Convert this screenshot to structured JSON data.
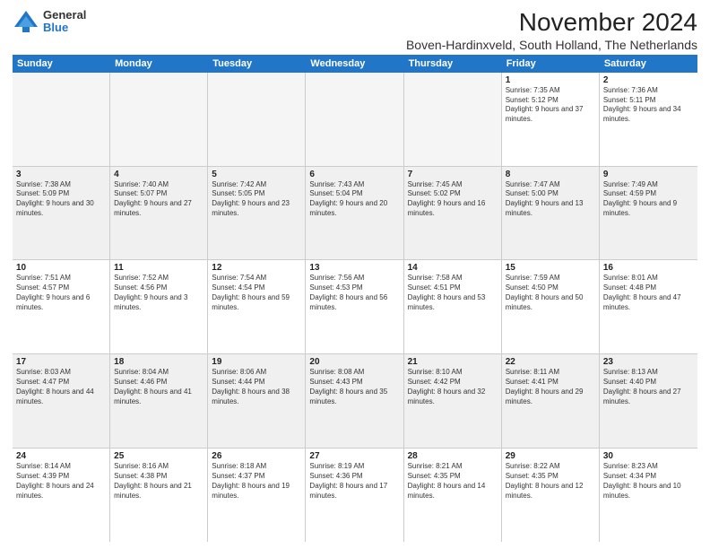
{
  "logo": {
    "general": "General",
    "blue": "Blue"
  },
  "title": "November 2024",
  "subtitle": "Boven-Hardinxveld, South Holland, The Netherlands",
  "days": [
    "Sunday",
    "Monday",
    "Tuesday",
    "Wednesday",
    "Thursday",
    "Friday",
    "Saturday"
  ],
  "weeks": [
    [
      {
        "day": "",
        "empty": true
      },
      {
        "day": "",
        "empty": true
      },
      {
        "day": "",
        "empty": true
      },
      {
        "day": "",
        "empty": true
      },
      {
        "day": "",
        "empty": true
      },
      {
        "day": "1",
        "info": "Sunrise: 7:35 AM\nSunset: 5:12 PM\nDaylight: 9 hours and 37 minutes."
      },
      {
        "day": "2",
        "info": "Sunrise: 7:36 AM\nSunset: 5:11 PM\nDaylight: 9 hours and 34 minutes."
      }
    ],
    [
      {
        "day": "3",
        "info": "Sunrise: 7:38 AM\nSunset: 5:09 PM\nDaylight: 9 hours and 30 minutes."
      },
      {
        "day": "4",
        "info": "Sunrise: 7:40 AM\nSunset: 5:07 PM\nDaylight: 9 hours and 27 minutes."
      },
      {
        "day": "5",
        "info": "Sunrise: 7:42 AM\nSunset: 5:05 PM\nDaylight: 9 hours and 23 minutes."
      },
      {
        "day": "6",
        "info": "Sunrise: 7:43 AM\nSunset: 5:04 PM\nDaylight: 9 hours and 20 minutes."
      },
      {
        "day": "7",
        "info": "Sunrise: 7:45 AM\nSunset: 5:02 PM\nDaylight: 9 hours and 16 minutes."
      },
      {
        "day": "8",
        "info": "Sunrise: 7:47 AM\nSunset: 5:00 PM\nDaylight: 9 hours and 13 minutes."
      },
      {
        "day": "9",
        "info": "Sunrise: 7:49 AM\nSunset: 4:59 PM\nDaylight: 9 hours and 9 minutes."
      }
    ],
    [
      {
        "day": "10",
        "info": "Sunrise: 7:51 AM\nSunset: 4:57 PM\nDaylight: 9 hours and 6 minutes."
      },
      {
        "day": "11",
        "info": "Sunrise: 7:52 AM\nSunset: 4:56 PM\nDaylight: 9 hours and 3 minutes."
      },
      {
        "day": "12",
        "info": "Sunrise: 7:54 AM\nSunset: 4:54 PM\nDaylight: 8 hours and 59 minutes."
      },
      {
        "day": "13",
        "info": "Sunrise: 7:56 AM\nSunset: 4:53 PM\nDaylight: 8 hours and 56 minutes."
      },
      {
        "day": "14",
        "info": "Sunrise: 7:58 AM\nSunset: 4:51 PM\nDaylight: 8 hours and 53 minutes."
      },
      {
        "day": "15",
        "info": "Sunrise: 7:59 AM\nSunset: 4:50 PM\nDaylight: 8 hours and 50 minutes."
      },
      {
        "day": "16",
        "info": "Sunrise: 8:01 AM\nSunset: 4:48 PM\nDaylight: 8 hours and 47 minutes."
      }
    ],
    [
      {
        "day": "17",
        "info": "Sunrise: 8:03 AM\nSunset: 4:47 PM\nDaylight: 8 hours and 44 minutes."
      },
      {
        "day": "18",
        "info": "Sunrise: 8:04 AM\nSunset: 4:46 PM\nDaylight: 8 hours and 41 minutes."
      },
      {
        "day": "19",
        "info": "Sunrise: 8:06 AM\nSunset: 4:44 PM\nDaylight: 8 hours and 38 minutes."
      },
      {
        "day": "20",
        "info": "Sunrise: 8:08 AM\nSunset: 4:43 PM\nDaylight: 8 hours and 35 minutes."
      },
      {
        "day": "21",
        "info": "Sunrise: 8:10 AM\nSunset: 4:42 PM\nDaylight: 8 hours and 32 minutes."
      },
      {
        "day": "22",
        "info": "Sunrise: 8:11 AM\nSunset: 4:41 PM\nDaylight: 8 hours and 29 minutes."
      },
      {
        "day": "23",
        "info": "Sunrise: 8:13 AM\nSunset: 4:40 PM\nDaylight: 8 hours and 27 minutes."
      }
    ],
    [
      {
        "day": "24",
        "info": "Sunrise: 8:14 AM\nSunset: 4:39 PM\nDaylight: 8 hours and 24 minutes."
      },
      {
        "day": "25",
        "info": "Sunrise: 8:16 AM\nSunset: 4:38 PM\nDaylight: 8 hours and 21 minutes."
      },
      {
        "day": "26",
        "info": "Sunrise: 8:18 AM\nSunset: 4:37 PM\nDaylight: 8 hours and 19 minutes."
      },
      {
        "day": "27",
        "info": "Sunrise: 8:19 AM\nSunset: 4:36 PM\nDaylight: 8 hours and 17 minutes."
      },
      {
        "day": "28",
        "info": "Sunrise: 8:21 AM\nSunset: 4:35 PM\nDaylight: 8 hours and 14 minutes."
      },
      {
        "day": "29",
        "info": "Sunrise: 8:22 AM\nSunset: 4:35 PM\nDaylight: 8 hours and 12 minutes."
      },
      {
        "day": "30",
        "info": "Sunrise: 8:23 AM\nSunset: 4:34 PM\nDaylight: 8 hours and 10 minutes."
      }
    ]
  ]
}
